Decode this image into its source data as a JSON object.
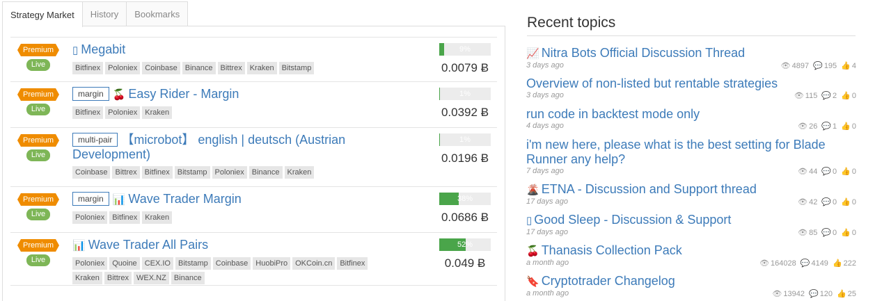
{
  "tabs": [
    {
      "label": "Strategy Market"
    },
    {
      "label": "History"
    },
    {
      "label": "Bookmarks"
    }
  ],
  "strategies": [
    {
      "premium": "Premium",
      "live": "Live",
      "tag": "",
      "icon": "square-icon",
      "icon_glyph": "▯",
      "name": "Megabit",
      "exchanges": [
        "Bitfinex",
        "Poloniex",
        "Coinbase",
        "Binance",
        "Bittrex",
        "Kraken",
        "Bitstamp"
      ],
      "progress_label": "9%",
      "progress": 0.09,
      "price": "0.0079 Ƀ"
    },
    {
      "premium": "Premium",
      "live": "Live",
      "tag": "margin",
      "icon": "cherry-icon",
      "icon_glyph": "🍒",
      "name": "Easy Rider - Margin",
      "exchanges": [
        "Bitfinex",
        "Poloniex",
        "Kraken"
      ],
      "progress_label": "1%",
      "progress": 0.01,
      "price": "0.0392 Ƀ"
    },
    {
      "premium": "Premium",
      "live": "Live",
      "tag": "multi-pair",
      "icon": "",
      "icon_glyph": "",
      "name": "【microbot】 english | deutsch (Austrian Development)",
      "exchanges": [
        "Coinbase",
        "Bittrex",
        "Bitfinex",
        "Bitstamp",
        "Poloniex",
        "Binance",
        "Kraken"
      ],
      "progress_label": "1%",
      "progress": 0.01,
      "price": "0.0196 Ƀ"
    },
    {
      "premium": "Premium",
      "live": "Live",
      "tag": "margin",
      "icon": "bar-chart-icon",
      "icon_glyph": "📊",
      "name": "Wave Trader Margin",
      "exchanges": [
        "Poloniex",
        "Bitfinex",
        "Kraken"
      ],
      "progress_label": "38%",
      "progress": 0.38,
      "price": "0.0686 Ƀ"
    },
    {
      "premium": "Premium",
      "live": "Live",
      "tag": "",
      "icon": "bar-chart-icon",
      "icon_glyph": "📊",
      "name": "Wave Trader All Pairs",
      "exchanges": [
        "Poloniex",
        "Quoine",
        "CEX.IO",
        "Bitstamp",
        "Coinbase",
        "HuobiPro",
        "OKCoin.cn",
        "Bitfinex",
        "Kraken",
        "Bittrex",
        "WEX.NZ",
        "Binance"
      ],
      "progress_label": "52%",
      "progress": 0.52,
      "price": "0.049 Ƀ"
    }
  ],
  "recent": {
    "title": "Recent topics",
    "topics": [
      {
        "icon": "chart-icon",
        "icon_glyph": "📈",
        "title": "Nitra Bots Official Discussion Thread",
        "date": "3 days ago",
        "views": "4897",
        "replies": "195",
        "likes": "4"
      },
      {
        "icon": "",
        "icon_glyph": "",
        "title": "Overview of non-listed but rentable strategies",
        "date": "3 days ago",
        "views": "115",
        "replies": "2",
        "likes": "0"
      },
      {
        "icon": "",
        "icon_glyph": "",
        "title": "run code in backtest mode only",
        "date": "4 days ago",
        "views": "26",
        "replies": "1",
        "likes": "0"
      },
      {
        "icon": "",
        "icon_glyph": "",
        "title": "i'm new here, please what is the best setting for Blade Runner any help?",
        "date": "7 days ago",
        "views": "44",
        "replies": "0",
        "likes": "0"
      },
      {
        "icon": "volcano-icon",
        "icon_glyph": "🌋",
        "title": "ETNA - Discussion and Support thread",
        "date": "17 days ago",
        "views": "42",
        "replies": "0",
        "likes": "0"
      },
      {
        "icon": "square-icon",
        "icon_glyph": "▯",
        "title": "Good Sleep - Discussion & Support",
        "date": "17 days ago",
        "views": "85",
        "replies": "0",
        "likes": "0"
      },
      {
        "icon": "cherry-icon",
        "icon_glyph": "🍒",
        "title": "Thanasis Collection Pack",
        "date": "a month ago",
        "views": "164028",
        "replies": "4149",
        "likes": "222"
      },
      {
        "icon": "bookmark-icon",
        "icon_glyph": "🔖",
        "title": "Cryptotrader Changelog",
        "date": "a month ago",
        "views": "13942",
        "replies": "120",
        "likes": "25"
      }
    ]
  },
  "stat_icons": {
    "views": "eye-icon",
    "replies": "comment-icon",
    "likes": "thumbs-up-icon"
  }
}
